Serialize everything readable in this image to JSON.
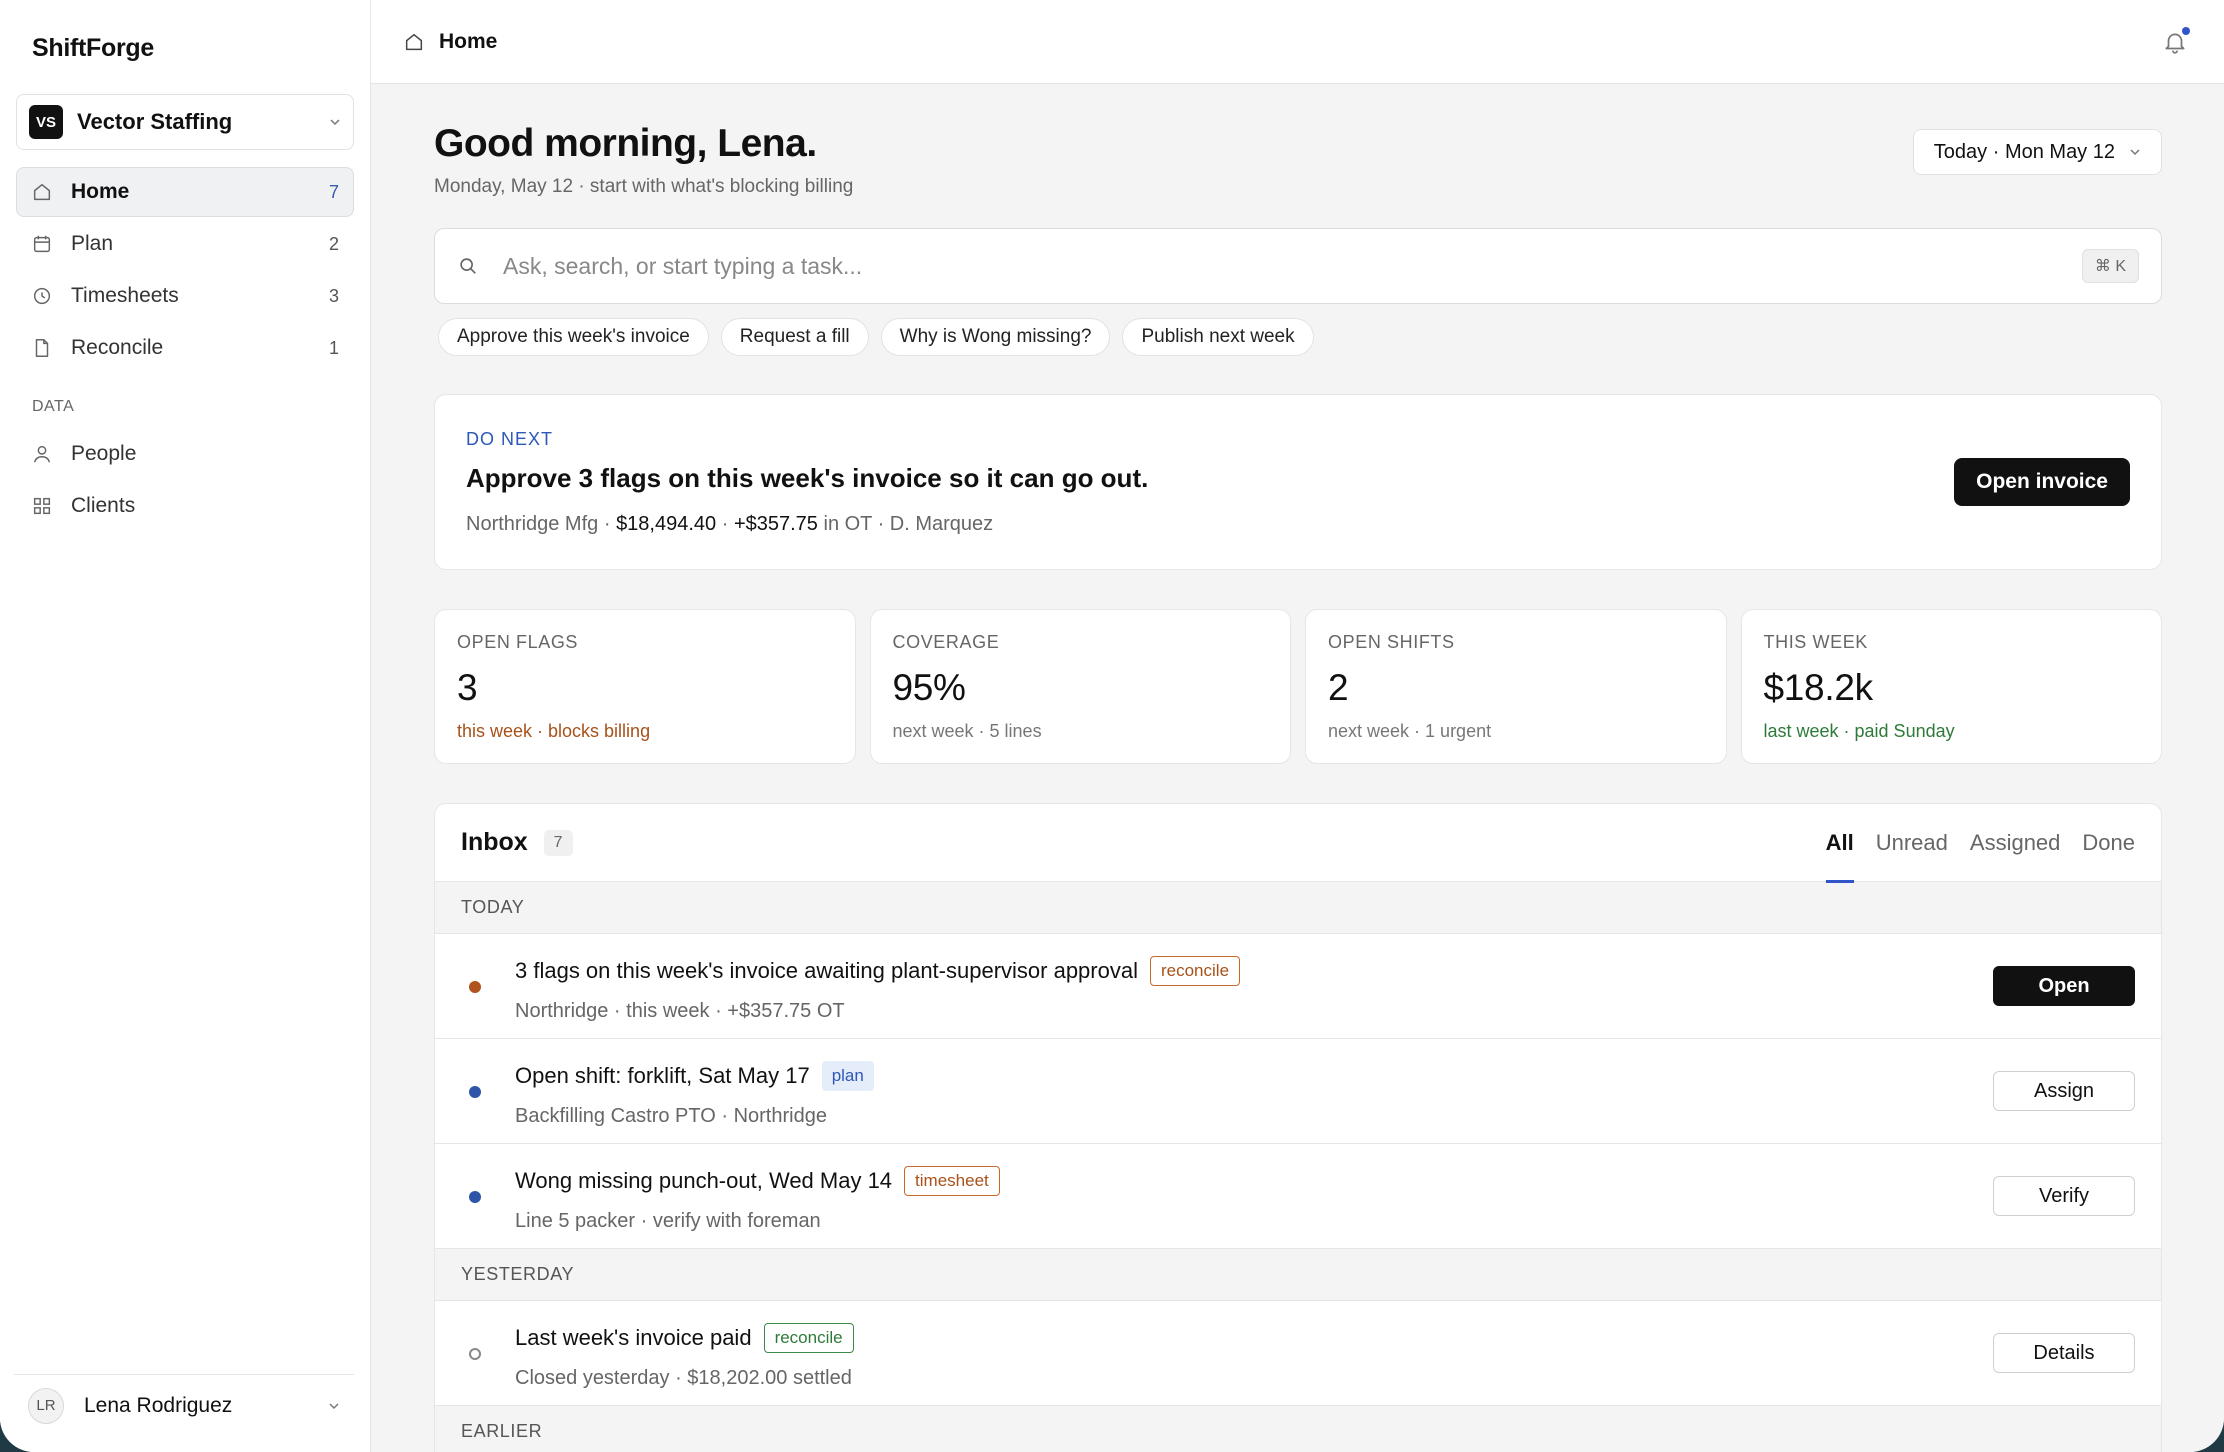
{
  "app": {
    "name": "ShiftForge"
  },
  "org": {
    "initials": "VS",
    "name": "Vector Staffing"
  },
  "nav": [
    {
      "label": "Home",
      "count": "7"
    },
    {
      "label": "Plan",
      "count": "2"
    },
    {
      "label": "Timesheets",
      "count": "3"
    },
    {
      "label": "Reconcile",
      "count": "1"
    }
  ],
  "data_section": {
    "label": "DATA",
    "items": [
      {
        "label": "People"
      },
      {
        "label": "Clients"
      }
    ]
  },
  "user": {
    "initials": "LR",
    "name": "Lena Rodriguez"
  },
  "topbar": {
    "breadcrumb": "Home"
  },
  "header": {
    "greeting": "Good morning, Lena.",
    "subtitle": "Monday, May 12 · start with what's blocking billing",
    "date_button": "Today · Mon May 12"
  },
  "search": {
    "placeholder": "Ask, search, or start typing a task...",
    "shortcut": "⌘ K"
  },
  "suggestions": [
    "Approve this week's invoice",
    "Request a fill",
    "Why is Wong missing?",
    "Publish next week"
  ],
  "do_next": {
    "label": "DO NEXT",
    "title": "Approve 3 flags on this week's invoice so it can go out.",
    "client": "Northridge Mfg · ",
    "amount": "$18,494.40",
    "sep": " · ",
    "ot": "+$357.75",
    "rest": " in OT · D. Marquez",
    "button": "Open invoice"
  },
  "stats": [
    {
      "label": "OPEN FLAGS",
      "value": "3",
      "sub": "this week · blocks billing",
      "tone": "warn",
      "color": "#a8521a"
    },
    {
      "label": "COVERAGE",
      "value": "95%",
      "sub": "next week · 5 lines",
      "tone": "neutral",
      "color": "#777777"
    },
    {
      "label": "OPEN SHIFTS",
      "value": "2",
      "sub": "next week · 1 urgent",
      "tone": "neutral",
      "color": "#777777"
    },
    {
      "label": "THIS WEEK",
      "value": "$18.2k",
      "sub": "last week · paid Sunday",
      "tone": "good",
      "color": "#2f7a3a"
    }
  ],
  "inbox": {
    "title": "Inbox",
    "count": "7",
    "tabs": [
      "All",
      "Unread",
      "Assigned",
      "Done"
    ],
    "active_tab": "All",
    "groups": [
      {
        "label": "TODAY",
        "items": [
          {
            "title": "3 flags on this week's invoice awaiting plant-supervisor approval",
            "tag": "reconcile",
            "tag_style": "orange",
            "sub": "Northridge · this week · +$357.75 OT",
            "button": "Open",
            "dot": "orange"
          },
          {
            "title": "Open shift: forklift, Sat May 17",
            "tag": "plan",
            "tag_style": "blue",
            "sub": "Backfilling Castro PTO · Northridge",
            "button": "Assign",
            "dot": "blue"
          },
          {
            "title": "Wong missing punch-out, Wed May 14",
            "tag": "timesheet",
            "tag_style": "orange",
            "sub": "Line 5 packer · verify with foreman",
            "button": "Verify",
            "dot": "blue"
          }
        ]
      },
      {
        "label": "YESTERDAY",
        "items": [
          {
            "title": "Last week's invoice paid",
            "tag": "reconcile",
            "tag_style": "green",
            "sub": "Closed yesterday · $18,202.00 settled",
            "button": "Details",
            "dot": "hollow"
          }
        ]
      },
      {
        "label": "EARLIER",
        "items": []
      }
    ]
  },
  "colors": {
    "accent": "#2f55c8",
    "warn": "#a8521a",
    "good": "#2f7a3a",
    "primary_button": "#111111"
  }
}
